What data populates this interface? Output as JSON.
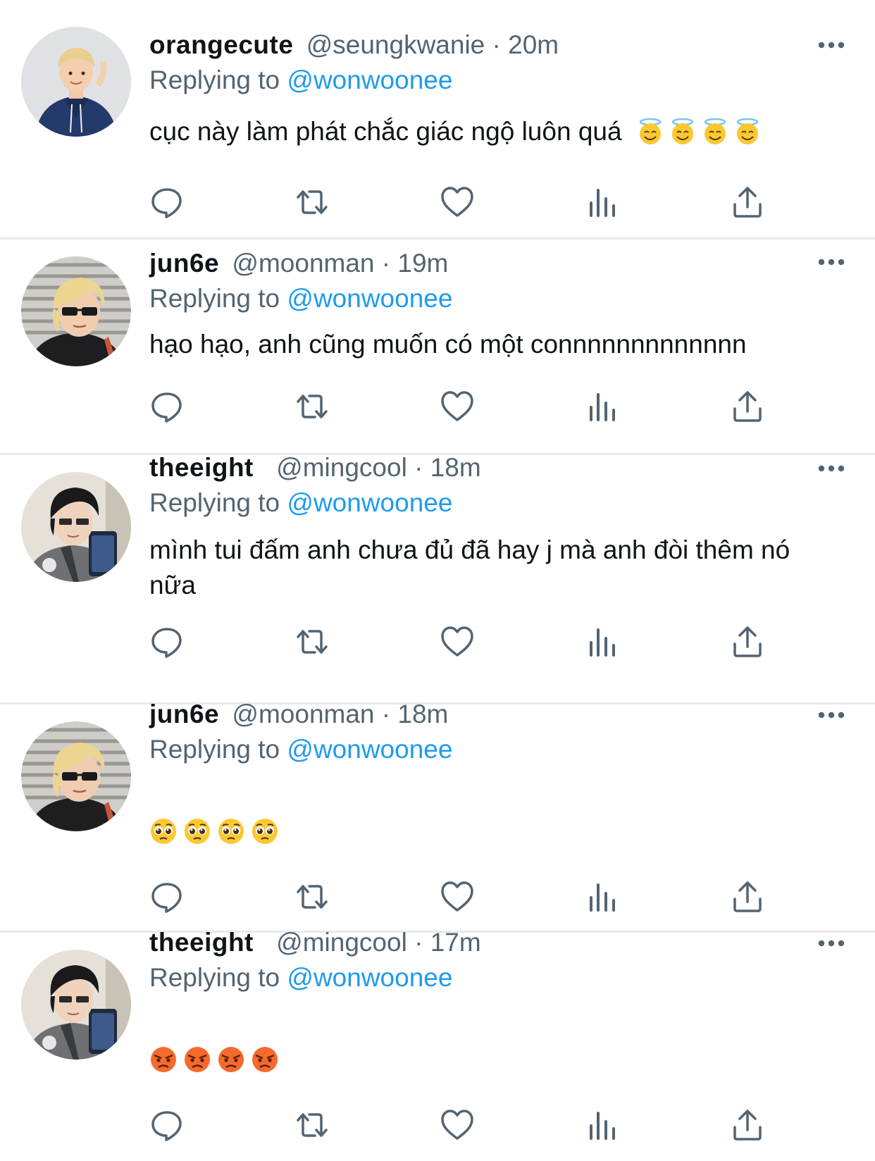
{
  "colors": {
    "mention": "#1d9bf0",
    "secondary_text": "#536471",
    "primary_text": "#0f1419",
    "divider": "#e7e9ea",
    "icon": "#536471"
  },
  "reply_prefix": "Replying to",
  "actions": [
    "reply-icon",
    "retweet-icon",
    "like-icon",
    "views-icon",
    "share-icon"
  ],
  "tweets": [
    {
      "display_name": "orangecute",
      "handle": "@seungkwanie",
      "separator": "·",
      "time": "20m",
      "replying_to": "@wonwoonee",
      "text": "cục này làm phát chắc giác ngộ luôn quá",
      "emojis": [
        "smiling-halo",
        "smiling-halo",
        "smiling-halo",
        "smiling-halo"
      ],
      "avatar": "blonde-hoodie-avatar"
    },
    {
      "display_name": "jun6e",
      "handle": "@moonman",
      "separator": "·",
      "time": "19m",
      "replying_to": "@wonwoonee",
      "text": "hạo hạo, anh cũng muốn có một connnnnnnnnnnnn",
      "emojis": [],
      "avatar": "blonde-sunglasses-avatar"
    },
    {
      "display_name": "theeight",
      "handle": "@mingcool",
      "separator": "·",
      "time": "18m",
      "replying_to": "@wonwoonee",
      "text": "mình tui đấm anh chưa đủ đã hay j mà anh đòi thêm nó nữa",
      "emojis": [],
      "avatar": "dark-hair-phone-avatar"
    },
    {
      "display_name": "jun6e",
      "handle": "@moonman",
      "separator": "·",
      "time": "18m",
      "replying_to": "@wonwoonee",
      "text": "",
      "emojis": [
        "pleading-face",
        "pleading-face",
        "pleading-face",
        "pleading-face"
      ],
      "avatar": "blonde-sunglasses-avatar"
    },
    {
      "display_name": "theeight",
      "handle": "@mingcool",
      "separator": "·",
      "time": "17m",
      "replying_to": "@wonwoonee",
      "text": "",
      "emojis": [
        "angry-face",
        "angry-face",
        "angry-face",
        "angry-face"
      ],
      "avatar": "dark-hair-phone-avatar"
    }
  ]
}
